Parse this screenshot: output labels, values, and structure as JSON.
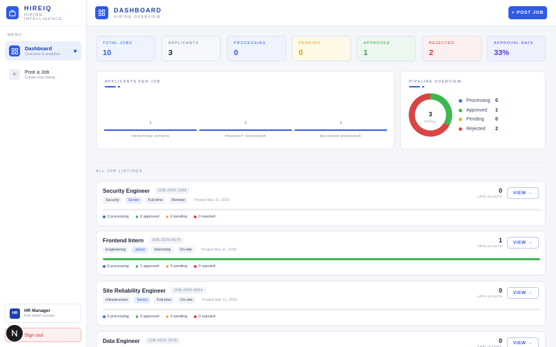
{
  "brand": {
    "name": "HIREIQ",
    "subtitle": "HIRING INTELLIGENCE"
  },
  "sidebar": {
    "menu_title": "MENU",
    "items": [
      {
        "label": "Dashboard",
        "sub": "Overview & analytics",
        "active": true,
        "icon": "grid-icon"
      },
      {
        "label": "Post a Job",
        "sub": "Create new listing",
        "active": false,
        "icon": "plus-icon"
      }
    ],
    "user": {
      "initials": "HR",
      "name": "HR Manager",
      "role": "Full admin access"
    },
    "signout_label": "Sign out"
  },
  "header": {
    "title": "DASHBOARD",
    "subtitle": "HIRING OVERVIEW",
    "post_button": "+ POST JOB"
  },
  "stats": [
    {
      "label": "TOTAL JOBS",
      "value": "10",
      "color": "#2f5be7",
      "bg": "#eef3fd"
    },
    {
      "label": "APPLICANTS",
      "value": "3",
      "color": "#1a1f36",
      "bg": "#f5f7fb"
    },
    {
      "label": "PROCESSING",
      "value": "0",
      "color": "#2f5be7",
      "bg": "#eef3fd"
    },
    {
      "label": "PENDING",
      "value": "0",
      "color": "#d4a017",
      "bg": "#fdf9e6"
    },
    {
      "label": "APPROVED",
      "value": "1",
      "color": "#2f9e44",
      "bg": "#ecf8ef"
    },
    {
      "label": "REJECTED",
      "value": "2",
      "color": "#d63333",
      "bg": "#fcefef"
    },
    {
      "label": "APPROVAL RATE",
      "value": "33%",
      "color": "#4a3fd8",
      "bg": "#eef0fd"
    }
  ],
  "applicants_chart": {
    "title": "APPLICANTS PER JOB",
    "chart_data": {
      "type": "bar",
      "categories": [
        "FRONTEND INTERN",
        "PRODUCT DESIGNER",
        "BACKEND ENGINEER"
      ],
      "values": [
        1,
        1,
        1
      ]
    }
  },
  "pipeline": {
    "title": "PIPELINE OVERVIEW",
    "total": "3",
    "total_label": "TOTAL",
    "chart_data": {
      "type": "pie",
      "categories": [
        "Processing",
        "Approved",
        "Pending",
        "Rejected"
      ],
      "values": [
        0,
        1,
        0,
        2
      ],
      "colors": [
        "#3b6fe0",
        "#3cb84c",
        "#e8b11c",
        "#d94545"
      ]
    }
  },
  "section_title": "ALL JOB LISTINGS",
  "jobs": [
    {
      "title": "Security Engineer",
      "id": "JOB-2026-1566",
      "dept": "Security",
      "level": "Senior",
      "type": "Full-time",
      "mode": "Remote",
      "posted": "Posted Mar 11, 2026",
      "applicants": "0",
      "progress": 0,
      "processing": "0 processing",
      "approved": "0 approved",
      "pending": "0 pending",
      "rejected": "0 rejected"
    },
    {
      "title": "Frontend Intern",
      "id": "JOB-2026-9579",
      "dept": "Engineering",
      "level": "Junior",
      "type": "Internship",
      "mode": "On-site",
      "posted": "Posted Mar 11, 2026",
      "applicants": "1",
      "progress": 1,
      "processing": "0 processing",
      "approved": "1 approved",
      "pending": "0 pending",
      "rejected": "0 rejected"
    },
    {
      "title": "Site Reliability Engineer",
      "id": "JOB-2026-8664",
      "dept": "Infrastructure",
      "level": "Senior",
      "type": "Full-time",
      "mode": "On-site",
      "posted": "Posted Mar 11, 2026",
      "applicants": "0",
      "progress": 0,
      "processing": "0 processing",
      "approved": "0 approved",
      "pending": "0 pending",
      "rejected": "0 rejected"
    },
    {
      "title": "Data Engineer",
      "id": "JOB-2026-1978",
      "applicants": "0"
    }
  ],
  "labels": {
    "applicants": "APPLICANTS",
    "view": "VIEW →"
  }
}
